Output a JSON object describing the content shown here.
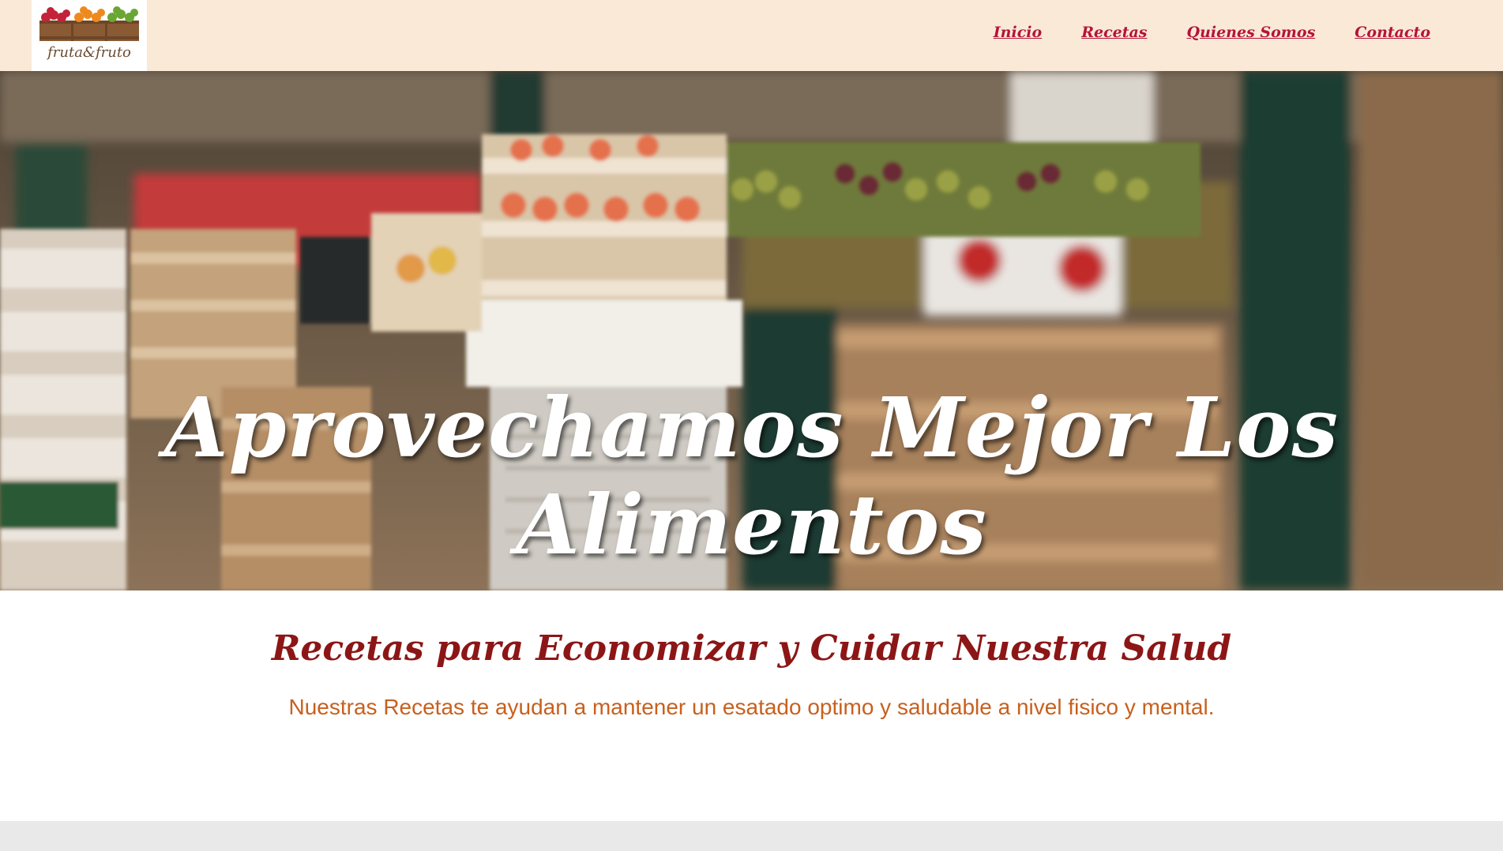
{
  "header": {
    "logo_text": "fruta&fruto",
    "nav": [
      "Inicio",
      "Recetas",
      "Quienes Somos",
      "Contacto"
    ]
  },
  "hero": {
    "title": "Aprovechamos Mejor Los Alimentos"
  },
  "section": {
    "title": "Recetas para Economizar y Cuidar Nuestra Salud",
    "text": "Nuestras Recetas te ayudan a mantener un esatado optimo y saludable a nivel fisico y mental."
  },
  "colors": {
    "header_bg": "#fae9d6",
    "nav_link": "#b5133a",
    "section_title": "#8c1616",
    "section_text": "#c8601e"
  }
}
